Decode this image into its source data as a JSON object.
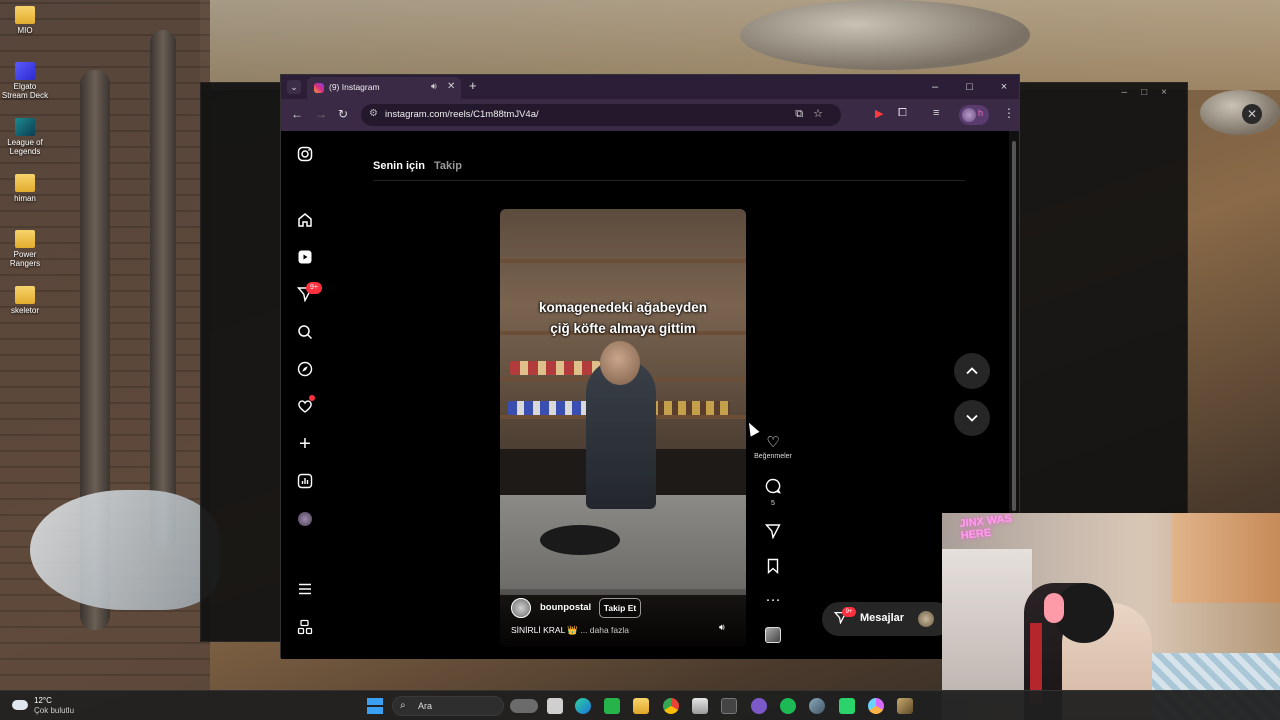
{
  "desktop": {
    "icons": [
      {
        "label": "MIO"
      },
      {
        "label": "Elgato Stream Deck"
      },
      {
        "label": "League of Legends"
      },
      {
        "label": "himan"
      },
      {
        "label": "Power Rangers"
      },
      {
        "label": "skeletor"
      }
    ]
  },
  "browser": {
    "tab_title": "(9) Instagram",
    "url": "instagram.com/reels/C1m88tmJV4a/",
    "window_buttons": {
      "minimize": "–",
      "maximize": "□",
      "close": "×"
    },
    "profile_initial": "h"
  },
  "instagram": {
    "sidebar": [
      {
        "name": "instagram-logo-icon"
      },
      {
        "name": "home-icon"
      },
      {
        "name": "reels-icon"
      },
      {
        "name": "direct-messages-icon",
        "badge": "9+"
      },
      {
        "name": "search-icon"
      },
      {
        "name": "explore-icon"
      },
      {
        "name": "notifications-heart-icon"
      },
      {
        "name": "create-plus-icon"
      },
      {
        "name": "dashboard-icon"
      },
      {
        "name": "profile-avatar"
      },
      {
        "name": "menu-icon"
      },
      {
        "name": "threads-more-icon"
      }
    ],
    "feed_tabs": {
      "for_you": "Senin için",
      "following": "Takip"
    },
    "reel": {
      "caption_line1": "komagenedeki ağabeyden",
      "caption_line2": "çiğ köfte almaya gittim",
      "account": "bounpostal",
      "follow_label": "Takip Et",
      "description": "SİNİRLİ KRAL 👑",
      "more_label": "... daha fazla"
    },
    "actions": {
      "likes_label": "Beğenmeler",
      "comments_count": "5"
    },
    "messages": {
      "label": "Mesajlar",
      "badge": "9+"
    }
  },
  "webcam": {
    "neon_sign": "JINX WAS HERE"
  },
  "taskbar": {
    "weather_temp": "12°C",
    "weather_condition": "Çok bulutlu",
    "search_placeholder": "Ara"
  },
  "colors": {
    "accent_badge": "#ff3040",
    "tab_bar": "#2b1e36",
    "address_bar": "#3a2a46"
  }
}
